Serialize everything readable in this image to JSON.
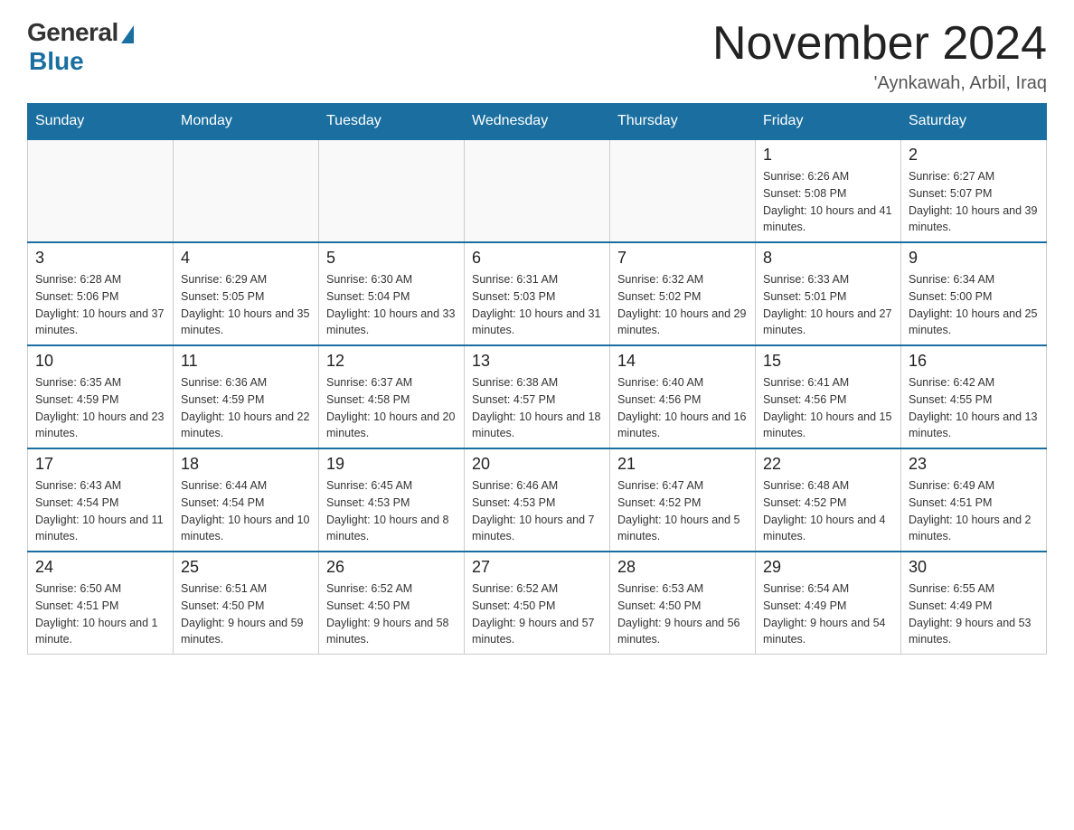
{
  "header": {
    "logo": {
      "general": "General",
      "blue": "Blue"
    },
    "title": "November 2024",
    "location": "'Aynkawah, Arbil, Iraq"
  },
  "days_of_week": [
    "Sunday",
    "Monday",
    "Tuesday",
    "Wednesday",
    "Thursday",
    "Friday",
    "Saturday"
  ],
  "weeks": [
    [
      {
        "day": "",
        "info": ""
      },
      {
        "day": "",
        "info": ""
      },
      {
        "day": "",
        "info": ""
      },
      {
        "day": "",
        "info": ""
      },
      {
        "day": "",
        "info": ""
      },
      {
        "day": "1",
        "info": "Sunrise: 6:26 AM\nSunset: 5:08 PM\nDaylight: 10 hours and 41 minutes."
      },
      {
        "day": "2",
        "info": "Sunrise: 6:27 AM\nSunset: 5:07 PM\nDaylight: 10 hours and 39 minutes."
      }
    ],
    [
      {
        "day": "3",
        "info": "Sunrise: 6:28 AM\nSunset: 5:06 PM\nDaylight: 10 hours and 37 minutes."
      },
      {
        "day": "4",
        "info": "Sunrise: 6:29 AM\nSunset: 5:05 PM\nDaylight: 10 hours and 35 minutes."
      },
      {
        "day": "5",
        "info": "Sunrise: 6:30 AM\nSunset: 5:04 PM\nDaylight: 10 hours and 33 minutes."
      },
      {
        "day": "6",
        "info": "Sunrise: 6:31 AM\nSunset: 5:03 PM\nDaylight: 10 hours and 31 minutes."
      },
      {
        "day": "7",
        "info": "Sunrise: 6:32 AM\nSunset: 5:02 PM\nDaylight: 10 hours and 29 minutes."
      },
      {
        "day": "8",
        "info": "Sunrise: 6:33 AM\nSunset: 5:01 PM\nDaylight: 10 hours and 27 minutes."
      },
      {
        "day": "9",
        "info": "Sunrise: 6:34 AM\nSunset: 5:00 PM\nDaylight: 10 hours and 25 minutes."
      }
    ],
    [
      {
        "day": "10",
        "info": "Sunrise: 6:35 AM\nSunset: 4:59 PM\nDaylight: 10 hours and 23 minutes."
      },
      {
        "day": "11",
        "info": "Sunrise: 6:36 AM\nSunset: 4:59 PM\nDaylight: 10 hours and 22 minutes."
      },
      {
        "day": "12",
        "info": "Sunrise: 6:37 AM\nSunset: 4:58 PM\nDaylight: 10 hours and 20 minutes."
      },
      {
        "day": "13",
        "info": "Sunrise: 6:38 AM\nSunset: 4:57 PM\nDaylight: 10 hours and 18 minutes."
      },
      {
        "day": "14",
        "info": "Sunrise: 6:40 AM\nSunset: 4:56 PM\nDaylight: 10 hours and 16 minutes."
      },
      {
        "day": "15",
        "info": "Sunrise: 6:41 AM\nSunset: 4:56 PM\nDaylight: 10 hours and 15 minutes."
      },
      {
        "day": "16",
        "info": "Sunrise: 6:42 AM\nSunset: 4:55 PM\nDaylight: 10 hours and 13 minutes."
      }
    ],
    [
      {
        "day": "17",
        "info": "Sunrise: 6:43 AM\nSunset: 4:54 PM\nDaylight: 10 hours and 11 minutes."
      },
      {
        "day": "18",
        "info": "Sunrise: 6:44 AM\nSunset: 4:54 PM\nDaylight: 10 hours and 10 minutes."
      },
      {
        "day": "19",
        "info": "Sunrise: 6:45 AM\nSunset: 4:53 PM\nDaylight: 10 hours and 8 minutes."
      },
      {
        "day": "20",
        "info": "Sunrise: 6:46 AM\nSunset: 4:53 PM\nDaylight: 10 hours and 7 minutes."
      },
      {
        "day": "21",
        "info": "Sunrise: 6:47 AM\nSunset: 4:52 PM\nDaylight: 10 hours and 5 minutes."
      },
      {
        "day": "22",
        "info": "Sunrise: 6:48 AM\nSunset: 4:52 PM\nDaylight: 10 hours and 4 minutes."
      },
      {
        "day": "23",
        "info": "Sunrise: 6:49 AM\nSunset: 4:51 PM\nDaylight: 10 hours and 2 minutes."
      }
    ],
    [
      {
        "day": "24",
        "info": "Sunrise: 6:50 AM\nSunset: 4:51 PM\nDaylight: 10 hours and 1 minute."
      },
      {
        "day": "25",
        "info": "Sunrise: 6:51 AM\nSunset: 4:50 PM\nDaylight: 9 hours and 59 minutes."
      },
      {
        "day": "26",
        "info": "Sunrise: 6:52 AM\nSunset: 4:50 PM\nDaylight: 9 hours and 58 minutes."
      },
      {
        "day": "27",
        "info": "Sunrise: 6:52 AM\nSunset: 4:50 PM\nDaylight: 9 hours and 57 minutes."
      },
      {
        "day": "28",
        "info": "Sunrise: 6:53 AM\nSunset: 4:50 PM\nDaylight: 9 hours and 56 minutes."
      },
      {
        "day": "29",
        "info": "Sunrise: 6:54 AM\nSunset: 4:49 PM\nDaylight: 9 hours and 54 minutes."
      },
      {
        "day": "30",
        "info": "Sunrise: 6:55 AM\nSunset: 4:49 PM\nDaylight: 9 hours and 53 minutes."
      }
    ]
  ]
}
